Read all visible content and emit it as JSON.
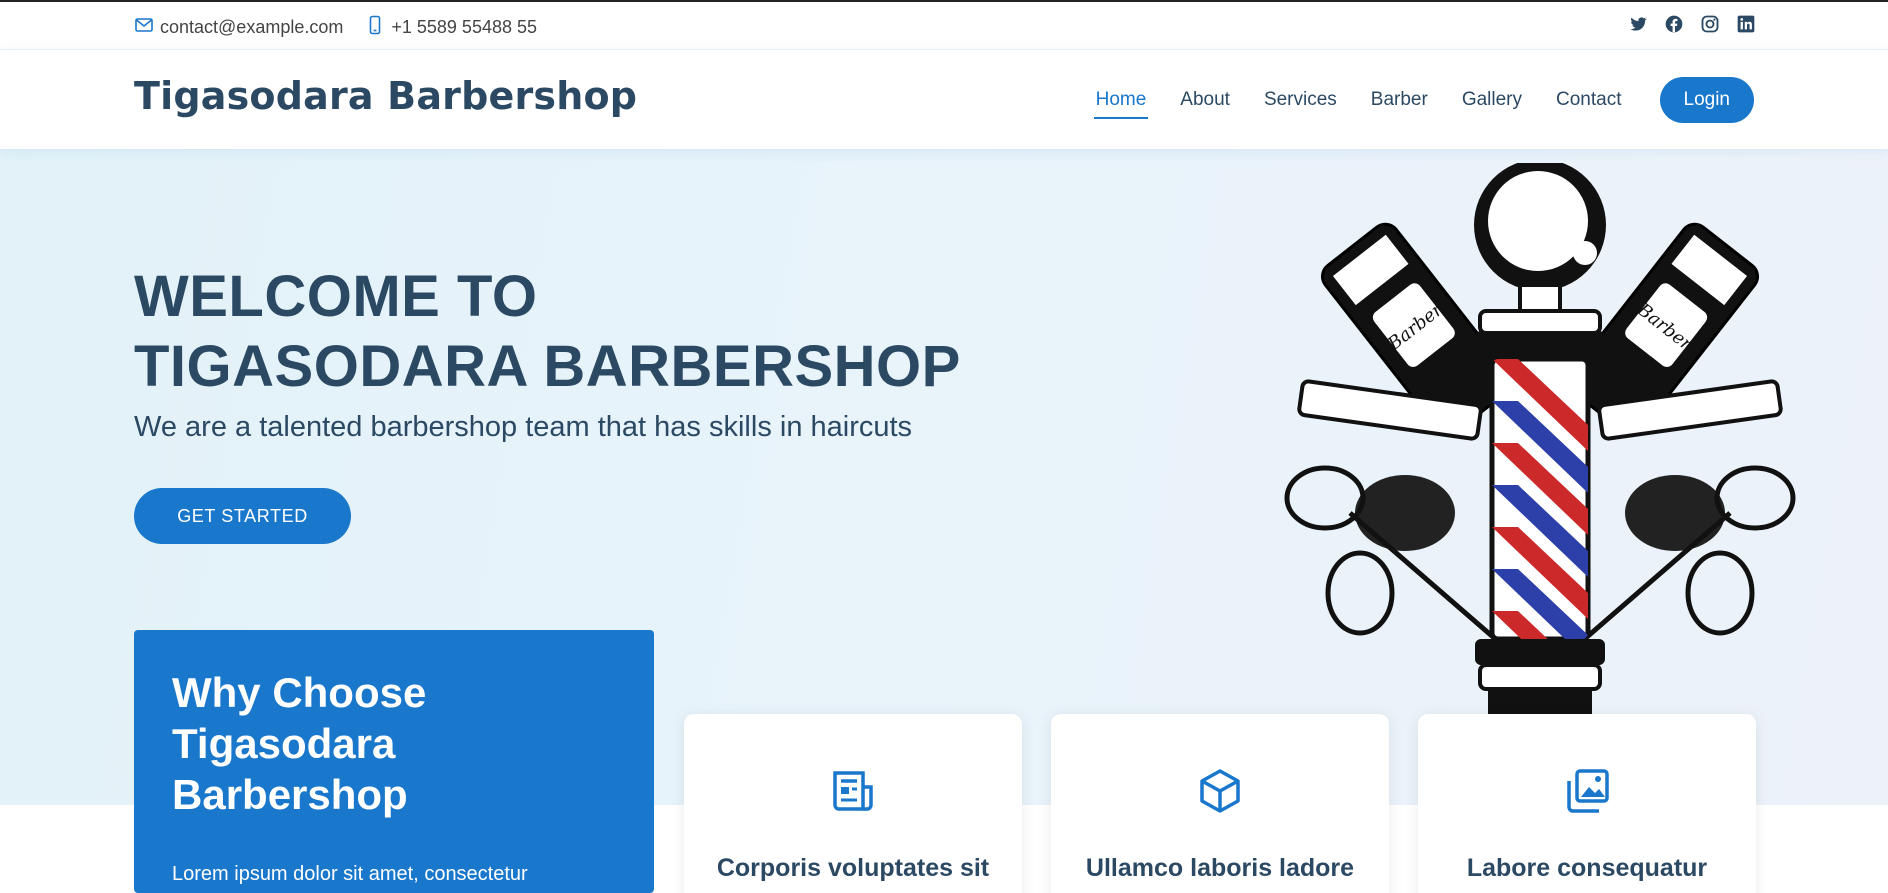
{
  "topbar": {
    "email": "contact@example.com",
    "phone": "+1 5589 55488 55",
    "social": [
      "twitter-icon",
      "facebook-icon",
      "instagram-icon",
      "linkedin-icon"
    ]
  },
  "header": {
    "logo": "Tigasodara Barbershop",
    "nav": [
      "Home",
      "About",
      "Services",
      "Barber",
      "Gallery",
      "Contact"
    ],
    "active_nav": "Home",
    "login": "Login"
  },
  "hero": {
    "title_line1": "WELCOME TO",
    "title_line2": "TIGASODARA BARBERSHOP",
    "subtitle": "We are a talented barbershop team that has skills in haircuts",
    "cta": "GET STARTED",
    "art_labels": [
      "Barber",
      "Barber"
    ]
  },
  "why": {
    "title": "Why Choose Tigasodara Barbershop",
    "text": "Lorem ipsum dolor sit amet, consectetur"
  },
  "cards": [
    {
      "icon": "receipt-icon",
      "title": "Corporis voluptates sit"
    },
    {
      "icon": "cube-icon",
      "title": "Ullamco laboris ladore"
    },
    {
      "icon": "images-icon",
      "title": "Labore consequatur"
    }
  ],
  "colors": {
    "accent": "#1977cc",
    "text": "#2c4964",
    "hero_bg": "#e8f3fa"
  }
}
